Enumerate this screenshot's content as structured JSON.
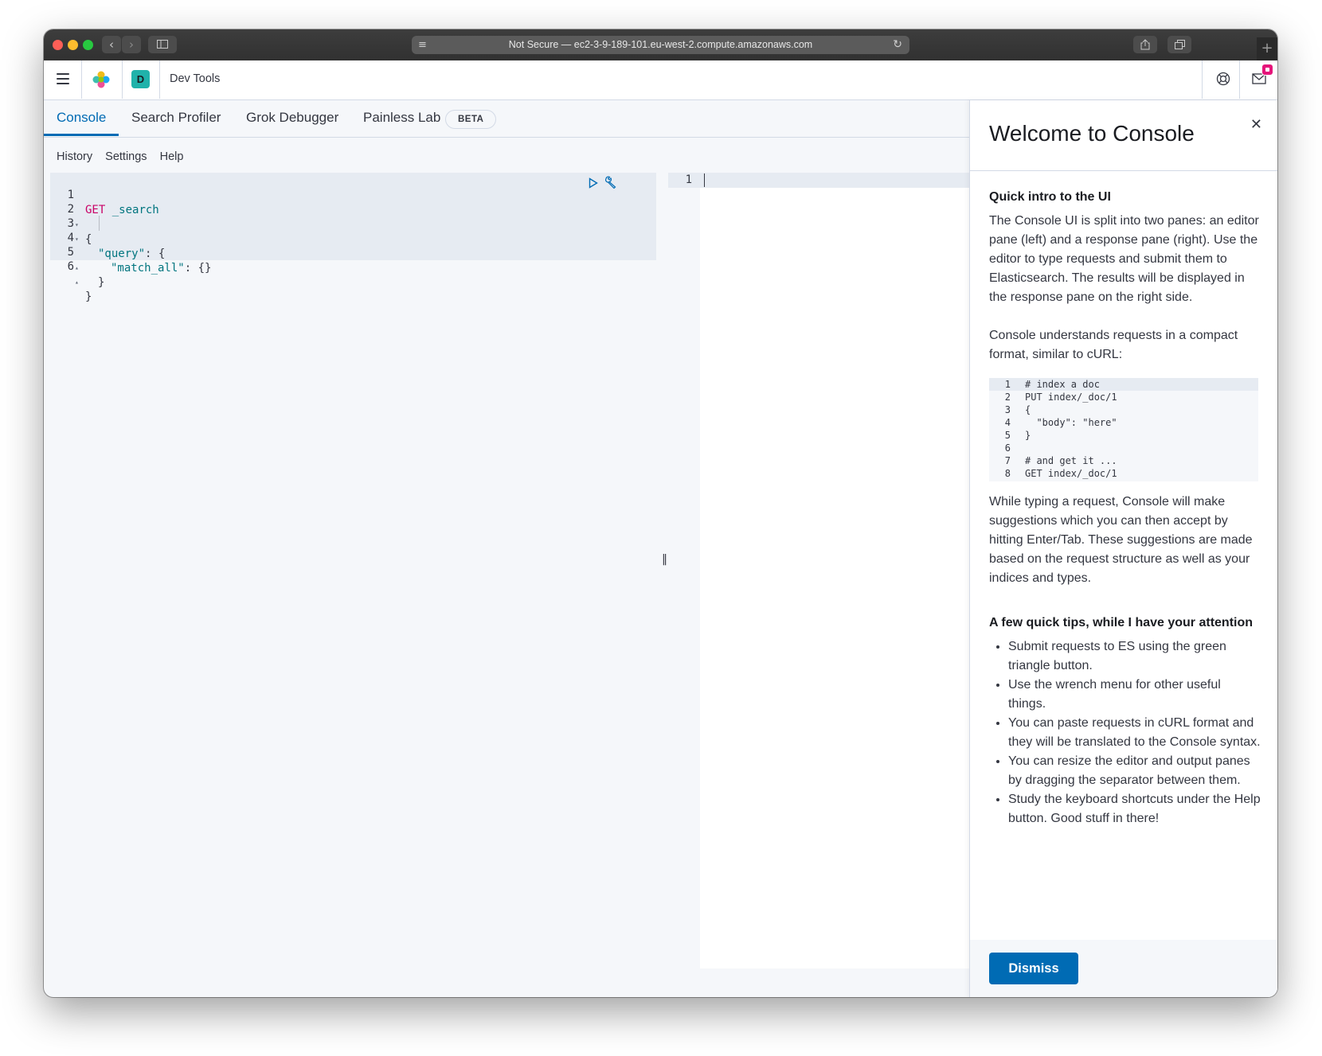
{
  "browser": {
    "url_text": "Not Secure — ec2-3-9-189-101.eu-west-2.compute.amazonaws.com",
    "new_tab_glyph": "+"
  },
  "header": {
    "avatar_letter": "D",
    "app_title": "Dev Tools"
  },
  "tabs": [
    {
      "label": "Console",
      "active": true
    },
    {
      "label": "Search Profiler",
      "active": false
    },
    {
      "label": "Grok Debugger",
      "active": false
    },
    {
      "label": "Painless Lab",
      "active": false
    }
  ],
  "beta_badge": "BETA",
  "submenu": {
    "history": "History",
    "settings": "Settings",
    "help": "Help"
  },
  "editor": {
    "lines": [
      {
        "num": "1",
        "method": "GET",
        "url": " _search",
        "text": ""
      },
      {
        "num": "2",
        "text": "{"
      },
      {
        "num": "3",
        "key": "\"query\"",
        "text": ": {"
      },
      {
        "num": "4",
        "key": "\"match_all\"",
        "text": ": {}"
      },
      {
        "num": "5",
        "text": "}"
      },
      {
        "num": "6",
        "text": "}"
      }
    ]
  },
  "output": {
    "line_num": "1"
  },
  "welcome": {
    "title": "Welcome to Console",
    "intro_heading": "Quick intro to the UI",
    "intro_p1": "The Console UI is split into two panes: an editor pane (left) and a response pane (right). Use the editor to type requests and submit them to Elasticsearch. The results will be displayed in the response pane on the right side.",
    "intro_p2": "Console understands requests in a compact format, similar to cURL:",
    "snippet": [
      {
        "num": "1",
        "code": "# index a doc"
      },
      {
        "num": "2",
        "code": "PUT index/_doc/1"
      },
      {
        "num": "3",
        "code": "{"
      },
      {
        "num": "4",
        "code": "  \"body\": \"here\""
      },
      {
        "num": "5",
        "code": "}"
      },
      {
        "num": "6",
        "code": ""
      },
      {
        "num": "7",
        "code": "# and get it ..."
      },
      {
        "num": "8",
        "code": "GET index/_doc/1"
      }
    ],
    "intro_p3": "While typing a request, Console will make suggestions which you can then accept by hitting Enter/Tab. These suggestions are made based on the request structure as well as your indices and types.",
    "tips_heading": "A few quick tips, while I have your attention",
    "tips": [
      "Submit requests to ES using the green triangle button.",
      "Use the wrench menu for other useful things.",
      "You can paste requests in cURL format and they will be translated to the Console syntax.",
      "You can resize the editor and output panes by dragging the separator between them.",
      "Study the keyboard shortcuts under the Help button. Good stuff in there!"
    ],
    "dismiss_label": "Dismiss"
  },
  "colors": {
    "accent": "#006bb4",
    "method": "#c90066",
    "string": "#00757f",
    "notification": "#e5157a",
    "avatar": "#20b2aa"
  }
}
